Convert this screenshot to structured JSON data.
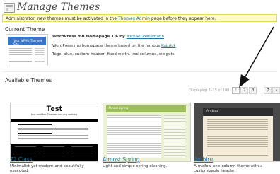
{
  "header": {
    "title": "Manage Themes"
  },
  "notice": {
    "text": "Administrator: new themes must be activated in the ",
    "link": "Themes Admin",
    "suffix": " page before they appear here."
  },
  "current_theme": {
    "heading": "Current Theme",
    "name_prefix": "WordPress mu Homepage 1.6 by ",
    "author": "Michael Heilemann",
    "description_prefix": "WordPress mu homepage theme based on the famous ",
    "description_link": "Kubrick",
    "tags": "Tags: blue, custom header, fixed width, two columns, widgets",
    "thumbnail_title": "Your WPMU Themed Site"
  },
  "available": {
    "heading": "Available Themes",
    "pagination": {
      "info": "Displaying 1–15 of 100",
      "pages": [
        "1",
        "2",
        "3",
        "…",
        "7",
        "»"
      ],
      "current": "1"
    },
    "themes": [
      {
        "name": "72 Class",
        "description": "Minimalist yet modern and beautifully executed.",
        "thumb_title": "Test",
        "thumb_subtitle": "Just another Themes.mu.org weblog"
      },
      {
        "name": "Almost Spring",
        "description": "Light and simple spring cleaning.",
        "thumb_title": "Almost Spring"
      },
      {
        "name": "Ambiru",
        "description": "A mellow one-column theme with a customizable header.",
        "thumb_title": "Ambiru"
      }
    ]
  },
  "colors": {
    "link": "#21759b",
    "notice_bg": "#fffbcc",
    "notice_border": "#e6db55",
    "arrow": "#111111"
  }
}
